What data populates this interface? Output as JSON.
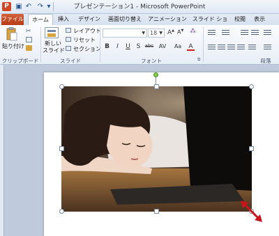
{
  "app": {
    "title": "プレゼンテーション1 - Microsoft PowerPoint",
    "logo_letter": "P"
  },
  "quick_access": {
    "icons": [
      "save-icon",
      "undo-icon",
      "redo-icon",
      "customize-icon"
    ],
    "glyphs": [
      "▣",
      "↶",
      "↷",
      "▾"
    ]
  },
  "tabs": [
    {
      "label": "ファイル",
      "kind": "file"
    },
    {
      "label": "ホーム",
      "kind": "active"
    },
    {
      "label": "挿入",
      "kind": "normal"
    },
    {
      "label": "デザイン",
      "kind": "normal"
    },
    {
      "label": "画面切り替え",
      "kind": "normal"
    },
    {
      "label": "アニメーション",
      "kind": "normal"
    },
    {
      "label": "スライド ショー",
      "kind": "normal"
    },
    {
      "label": "校閲",
      "kind": "normal"
    },
    {
      "label": "表示",
      "kind": "normal"
    }
  ],
  "ribbon": {
    "clipboard": {
      "paste_label": "貼り付け",
      "group_label": "クリップボード"
    },
    "slides": {
      "new_slide_label_1": "新しい",
      "new_slide_label_2": "スライド",
      "layout_label": "レイアウト",
      "reset_label": "リセット",
      "section_label": "セクション",
      "group_label": "スライド"
    },
    "font": {
      "size_value": "18",
      "group_label": "フォント",
      "buttons": [
        "B",
        "I",
        "U",
        "S",
        "abc",
        "AV",
        "Aa",
        "A"
      ]
    },
    "paragraph": {
      "group_label": "段落"
    }
  },
  "colors": {
    "file_tab": "#c44a22",
    "resize_arrow": "#c8151b",
    "rotate_handle": "#7ed04b"
  }
}
